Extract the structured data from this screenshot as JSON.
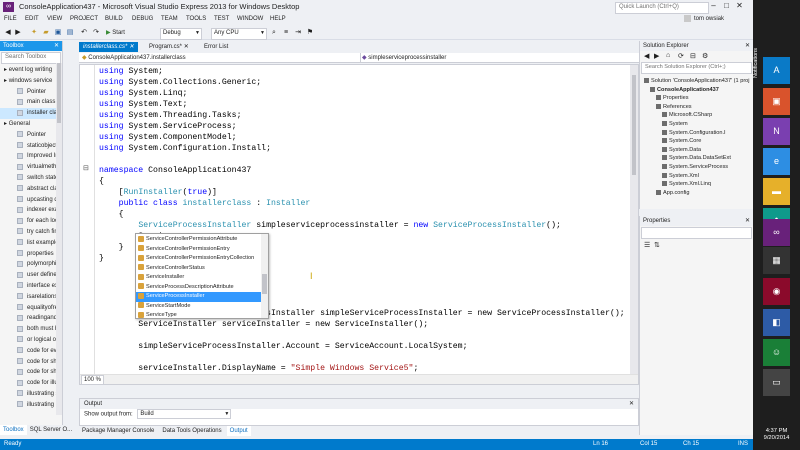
{
  "window": {
    "title": "ConsoleApplication437 - Microsoft Visual Studio Express 2013 for Windows Desktop",
    "quick_launch_placeholder": "Quick Launch (Ctrl+Q)",
    "user_name": "tom owsiak"
  },
  "menu": [
    "FILE",
    "EDIT",
    "VIEW",
    "PROJECT",
    "BUILD",
    "DEBUG",
    "TEAM",
    "TOOLS",
    "TEST",
    "WINDOW",
    "HELP"
  ],
  "toolbar": {
    "start_label": "Start",
    "config_value": "Debug",
    "platform_value": "Any CPU"
  },
  "toolbox": {
    "title": "Toolbox",
    "search_placeholder": "Search Toolbox",
    "items": [
      {
        "label": "event log writing",
        "group": true
      },
      {
        "label": "windows service",
        "group": true
      },
      {
        "label": "Pointer",
        "group": false
      },
      {
        "label": "main class",
        "group": false
      },
      {
        "label": "installer class",
        "group": false,
        "selected": true
      },
      {
        "label": "General",
        "group": true
      },
      {
        "label": "Pointer",
        "group": false
      },
      {
        "label": "staticobject...",
        "group": false
      },
      {
        "label": "Improved In...",
        "group": false
      },
      {
        "label": "virtualmeth...",
        "group": false
      },
      {
        "label": "switch state...",
        "group": false
      },
      {
        "label": "abstract clas...",
        "group": false
      },
      {
        "label": "upcasting d...",
        "group": false
      },
      {
        "label": "indexer exa...",
        "group": false
      },
      {
        "label": "for each loop",
        "group": false
      },
      {
        "label": "try catch fin...",
        "group": false
      },
      {
        "label": "list example",
        "group": false
      },
      {
        "label": "properties",
        "group": false
      },
      {
        "label": "polymorphi...",
        "group": false
      },
      {
        "label": "user defined...",
        "group": false
      },
      {
        "label": "interface ex...",
        "group": false
      },
      {
        "label": "isarelations...",
        "group": false
      },
      {
        "label": "equalityofre...",
        "group": false
      },
      {
        "label": "readingand...",
        "group": false
      },
      {
        "label": "both must b...",
        "group": false
      },
      {
        "label": "or logical o...",
        "group": false
      },
      {
        "label": "code for eva...",
        "group": false
      },
      {
        "label": "code for sh...",
        "group": false
      },
      {
        "label": "code for sh...",
        "group": false
      },
      {
        "label": "code for illu...",
        "group": false
      },
      {
        "label": "illustrating s...",
        "group": false
      },
      {
        "label": "illustrating ...",
        "group": false
      }
    ],
    "bottom_tabs": [
      "Toolbox",
      "SQL Server O..."
    ]
  },
  "doc_tabs": [
    {
      "label": "installerclass.cs*",
      "active": true
    },
    {
      "label": "Program.cs*",
      "active": false
    },
    {
      "label": "Error List",
      "active": false
    }
  ],
  "navbar": {
    "left": "ConsoleApplication437.installerclass",
    "right": "simpleserviceprocessinstaller"
  },
  "editor": {
    "zoom": "100 %",
    "lines": [
      [
        [
          "kw",
          "using"
        ],
        [
          "",
          " System;"
        ]
      ],
      [
        [
          "kw",
          "using"
        ],
        [
          "",
          " System.Collections.Generic;"
        ]
      ],
      [
        [
          "kw",
          "using"
        ],
        [
          "",
          " System.Linq;"
        ]
      ],
      [
        [
          "kw",
          "using"
        ],
        [
          "",
          " System.Text;"
        ]
      ],
      [
        [
          "kw",
          "using"
        ],
        [
          "",
          " System.Threading.Tasks;"
        ]
      ],
      [
        [
          "kw",
          "using"
        ],
        [
          "",
          " System.ServiceProcess;"
        ]
      ],
      [
        [
          "kw",
          "using"
        ],
        [
          "",
          " System.ComponentModel;"
        ]
      ],
      [
        [
          "kw",
          "using"
        ],
        [
          "",
          " System.Configuration.Install;"
        ]
      ],
      [],
      [
        [
          "kw",
          "namespace"
        ],
        [
          "",
          " ConsoleApplication437"
        ]
      ],
      [
        [
          "",
          "{"
        ]
      ],
      [
        [
          "",
          "    ["
        ],
        [
          "ty",
          "RunInstaller"
        ],
        [
          "",
          "("
        ],
        [
          "kw",
          "true"
        ],
        [
          "",
          ")]"
        ]
      ],
      [
        [
          "",
          "    "
        ],
        [
          "kw",
          "public class"
        ],
        [
          "",
          " "
        ],
        [
          "ty",
          "installerclass"
        ],
        [
          "",
          " : "
        ],
        [
          "ty",
          "Installer"
        ]
      ],
      [
        [
          "",
          "    {"
        ]
      ],
      [
        [
          "",
          "        "
        ],
        [
          "ty",
          "ServiceProcessInstaller"
        ],
        [
          "",
          " simpleserviceprocessinstaller = "
        ],
        [
          "kw",
          "new"
        ],
        [
          "",
          " "
        ],
        [
          "ty",
          "ServiceProcessInstaller"
        ],
        [
          "",
          "();"
        ]
      ],
      [
        [
          "",
          "        Servic"
        ]
      ],
      [
        [
          "",
          "    }"
        ]
      ],
      [
        [
          "",
          "}"
        ]
      ],
      [],
      [],
      [],
      [],
      [
        [
          "",
          "                   leServiceProcessInstaller simpleServiceProcessInstaller = new ServiceProcessInstaller();"
        ]
      ],
      [
        [
          "",
          "        ServiceInstaller serviceInstaller = new ServiceInstaller();"
        ]
      ],
      [],
      [
        [
          "",
          "        simpleServiceProcessInstaller.Account = ServiceAccount.LocalSystem;"
        ]
      ],
      [],
      [
        [
          "",
          "        serviceInstaller.DisplayName = "
        ],
        [
          "st",
          "\"Simple Windows Service5\""
        ],
        [
          "",
          ";"
        ]
      ],
      [
        [
          "",
          "        serviceInstaller.StartType = ServiceStartMode.Manual;"
        ]
      ]
    ]
  },
  "intellisense": {
    "items": [
      "ServiceControllerPermissionAttribute",
      "ServiceControllerPermissionEntry",
      "ServiceControllerPermissionEntryCollection",
      "ServiceControllerStatus",
      "ServiceInstaller",
      "ServiceProcessDescriptionAttribute",
      "ServiceProcessInstaller",
      "ServiceStartMode",
      "ServiceType"
    ],
    "selected_index": 6
  },
  "output": {
    "title": "Output",
    "show_output_label": "Show output from:",
    "show_output_value": "Build",
    "tabs": [
      "Package Manager Console",
      "Data Tools Operations",
      "Output"
    ]
  },
  "solution_explorer": {
    "title": "Solution Explorer",
    "search_placeholder": "Search Solution Explorer (Ctrl+;)",
    "items": [
      {
        "label": "Solution 'ConsoleApplication437' (1 proj",
        "indent": 0,
        "bold": false
      },
      {
        "label": "ConsoleApplication437",
        "indent": 1,
        "bold": true
      },
      {
        "label": "Properties",
        "indent": 2,
        "bold": false
      },
      {
        "label": "References",
        "indent": 2,
        "bold": false
      },
      {
        "label": "Microsoft.CSharp",
        "indent": 3,
        "bold": false
      },
      {
        "label": "System",
        "indent": 3,
        "bold": false
      },
      {
        "label": "System.Configuration.I",
        "indent": 3,
        "bold": false
      },
      {
        "label": "System.Core",
        "indent": 3,
        "bold": false
      },
      {
        "label": "System.Data",
        "indent": 3,
        "bold": false
      },
      {
        "label": "System.Data.DataSetExt",
        "indent": 3,
        "bold": false
      },
      {
        "label": "System.ServiceProcess",
        "indent": 3,
        "bold": false
      },
      {
        "label": "System.Xml",
        "indent": 3,
        "bold": false
      },
      {
        "label": "System.Xml.Linq",
        "indent": 3,
        "bold": false
      },
      {
        "label": "App.config",
        "indent": 2,
        "bold": false
      }
    ]
  },
  "properties": {
    "title": "Properties"
  },
  "charms": {
    "notifications_label": "Notifications",
    "time": "4:37 PM",
    "date": "9/20/2014"
  },
  "statusbar": {
    "ready": "Ready",
    "line": "Ln 16",
    "col": "Col 15",
    "ch": "Ch 15",
    "ins": "INS"
  },
  "colors": {
    "accent": "#007acc",
    "toolbox_header": "#1c97ea",
    "selection": "#3399ff",
    "keyword": "#0000ff",
    "type": "#2b91af",
    "string": "#a31515"
  }
}
